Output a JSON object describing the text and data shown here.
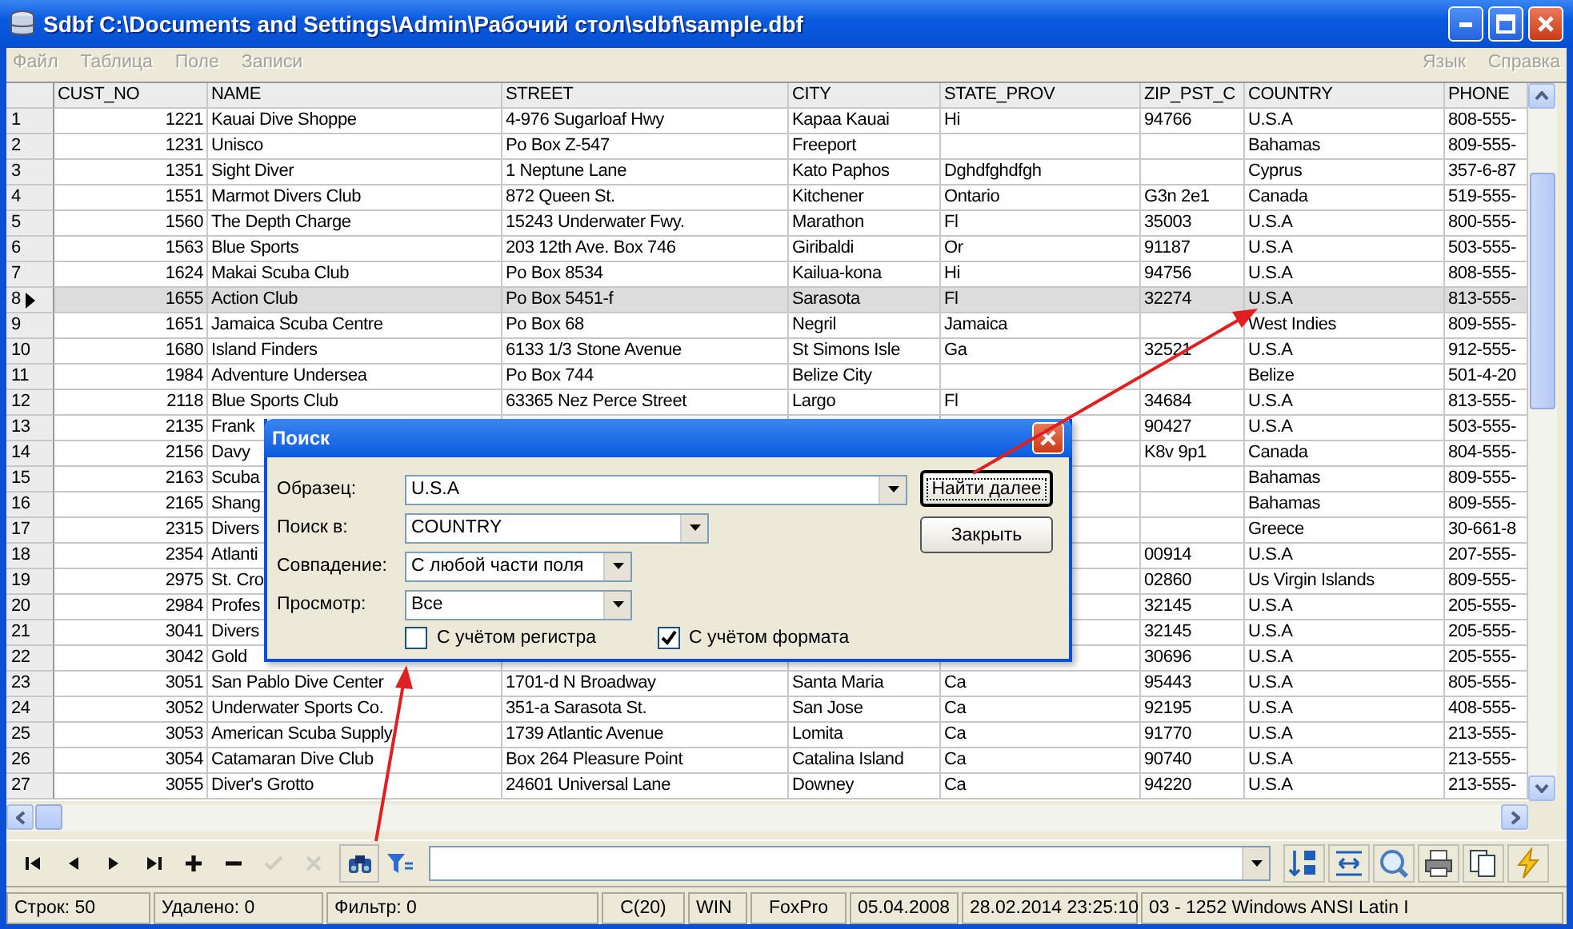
{
  "window": {
    "title": "Sdbf C:\\Documents and Settings\\Admin\\Рабочий стол\\sdbf\\sample.dbf"
  },
  "menu": {
    "left": [
      "Файл",
      "Таблица",
      "Поле",
      "Записи"
    ],
    "right": [
      "Язык",
      "Справка"
    ]
  },
  "table": {
    "columns": [
      "CUST_NO",
      "NAME",
      "STREET",
      "CITY",
      "STATE_PROV",
      "ZIP_PST_C",
      "COUNTRY",
      "PHONE"
    ],
    "rows": [
      {
        "number": "1",
        "selected": false,
        "cells": [
          "1221",
          "Kauai Dive Shoppe",
          "4-976 Sugarloaf Hwy",
          "Kapaa Kauai",
          "Hi",
          "94766",
          "U.S.A",
          "808-555-"
        ]
      },
      {
        "number": "2",
        "selected": false,
        "cells": [
          "1231",
          "Unisco",
          "Po Box Z-547",
          "Freeport",
          null,
          null,
          "Bahamas",
          "809-555-"
        ]
      },
      {
        "number": "3",
        "selected": false,
        "cells": [
          "1351",
          "Sight Diver",
          "1 Neptune Lane",
          "Kato Paphos",
          "Dghdfghdfgh",
          null,
          "Cyprus",
          "357-6-87"
        ]
      },
      {
        "number": "4",
        "selected": false,
        "cells": [
          "1551",
          "Marmot Divers Club",
          "872 Queen St.",
          "Kitchener",
          "Ontario",
          "G3n 2e1",
          "Canada",
          "519-555-"
        ]
      },
      {
        "number": "5",
        "selected": false,
        "cells": [
          "1560",
          "The Depth Charge",
          "15243 Underwater Fwy.",
          "Marathon",
          "Fl",
          "35003",
          "U.S.A",
          "800-555-"
        ]
      },
      {
        "number": "6",
        "selected": false,
        "cells": [
          "1563",
          "Blue Sports",
          "203 12th Ave. Box 746",
          "Giribaldi",
          "Or",
          "91187",
          "U.S.A",
          "503-555-"
        ]
      },
      {
        "number": "7",
        "selected": false,
        "cells": [
          "1624",
          "Makai Scuba Club",
          "Po Box 8534",
          "Kailua-kona",
          "Hi",
          "94756",
          "U.S.A",
          "808-555-"
        ]
      },
      {
        "number": "8",
        "selected": true,
        "cells": [
          "1655",
          "Action Club",
          "Po Box 5451-f",
          "Sarasota",
          "Fl",
          "32274",
          "U.S.A",
          "813-555-"
        ]
      },
      {
        "number": "9",
        "selected": false,
        "cells": [
          "1651",
          "Jamaica Scuba Centre",
          "Po Box 68",
          "Negril",
          "Jamaica",
          null,
          "West Indies",
          "809-555-"
        ]
      },
      {
        "number": "10",
        "selected": false,
        "cells": [
          "1680",
          "Island Finders",
          "6133 1/3 Stone Avenue",
          "St Simons Isle",
          "Ga",
          "32521",
          "U.S.A",
          "912-555-"
        ]
      },
      {
        "number": "11",
        "selected": false,
        "cells": [
          "1984",
          "Adventure Undersea",
          "Po Box 744",
          "Belize City",
          null,
          null,
          "Belize",
          "501-4-20"
        ]
      },
      {
        "number": "12",
        "selected": false,
        "cells": [
          "2118",
          "Blue Sports Club",
          "63365 Nez Perce Street",
          "Largo",
          "Fl",
          "34684",
          "U.S.A",
          "813-555-"
        ]
      },
      {
        "number": "13",
        "selected": false,
        "cells": [
          "2135",
          "Frank",
          null,
          null,
          null,
          "90427",
          "U.S.A",
          "503-555-"
        ]
      },
      {
        "number": "14",
        "selected": false,
        "cells": [
          "2156",
          "Davy",
          null,
          null,
          null,
          "K8v 9p1",
          "Canada",
          "804-555-"
        ]
      },
      {
        "number": "15",
        "selected": false,
        "cells": [
          "2163",
          "Scuba",
          null,
          null,
          null,
          null,
          "Bahamas",
          "809-555-"
        ]
      },
      {
        "number": "16",
        "selected": false,
        "cells": [
          "2165",
          "Shang",
          null,
          null,
          null,
          null,
          "Bahamas",
          "809-555-"
        ]
      },
      {
        "number": "17",
        "selected": false,
        "cells": [
          "2315",
          "Divers",
          null,
          null,
          null,
          null,
          "Greece",
          "30-661-8"
        ]
      },
      {
        "number": "18",
        "selected": false,
        "cells": [
          "2354",
          "Atlanti",
          null,
          null,
          null,
          "00914",
          "U.S.A",
          "207-555-"
        ]
      },
      {
        "number": "19",
        "selected": false,
        "cells": [
          "2975",
          "St. Cro",
          null,
          null,
          null,
          "02860",
          "Us Virgin Islands",
          "809-555-"
        ]
      },
      {
        "number": "20",
        "selected": false,
        "cells": [
          "2984",
          "Profes",
          null,
          null,
          null,
          "32145",
          "U.S.A",
          "205-555-"
        ]
      },
      {
        "number": "21",
        "selected": false,
        "cells": [
          "3041",
          "Divers",
          null,
          null,
          null,
          "32145",
          "U.S.A",
          "205-555-"
        ]
      },
      {
        "number": "22",
        "selected": false,
        "cells": [
          "3042",
          "Gold",
          null,
          null,
          null,
          "30696",
          "U.S.A",
          "205-555-"
        ]
      },
      {
        "number": "23",
        "selected": false,
        "cells": [
          "3051",
          "San Pablo Dive Center",
          "1701-d N Broadway",
          "Santa Maria",
          "Ca",
          "95443",
          "U.S.A",
          "805-555-"
        ]
      },
      {
        "number": "24",
        "selected": false,
        "cells": [
          "3052",
          "Underwater Sports Co.",
          "351-a Sarasota St.",
          "San Jose",
          "Ca",
          "92195",
          "U.S.A",
          "408-555-"
        ]
      },
      {
        "number": "25",
        "selected": false,
        "cells": [
          "3053",
          "American Scuba Supply",
          "1739 Atlantic Avenue",
          "Lomita",
          "Ca",
          "91770",
          "U.S.A",
          "213-555-"
        ]
      },
      {
        "number": "26",
        "selected": false,
        "cells": [
          "3054",
          "Catamaran Dive Club",
          "Box 264 Pleasure Point",
          "Catalina Island",
          "Ca",
          "90740",
          "U.S.A",
          "213-555-"
        ]
      },
      {
        "number": "27",
        "selected": false,
        "cells": [
          "3055",
          "Diver's Grotto",
          "24601 Universal Lane",
          "Downey",
          "Ca",
          "94220",
          "U.S.A",
          "213-555-"
        ]
      }
    ]
  },
  "dialog": {
    "title": "Поиск",
    "fields": [
      {
        "label": "Образец:",
        "value": "U.S.A"
      },
      {
        "label": "Поиск в:",
        "value": "COUNTRY"
      },
      {
        "label": "Совпадение:",
        "value": "С любой части поля"
      },
      {
        "label": "Просмотр:",
        "value": "Все"
      }
    ],
    "checkboxes": [
      {
        "label": "С учётом регистра",
        "checked": false
      },
      {
        "label": "С учётом формата",
        "checked": true
      }
    ],
    "buttons": [
      {
        "label": "Найти далее",
        "default": true
      },
      {
        "label": "Закрыть",
        "default": false
      }
    ]
  },
  "toolbar": {
    "buttons": [
      {
        "kind": "first",
        "disabled": false
      },
      {
        "kind": "prev",
        "disabled": false
      },
      {
        "kind": "next",
        "disabled": false
      },
      {
        "kind": "last",
        "disabled": false
      },
      {
        "kind": "add",
        "disabled": false
      },
      {
        "kind": "remove",
        "disabled": false
      },
      {
        "kind": "confirm",
        "disabled": true
      },
      {
        "kind": "cancel",
        "disabled": true
      },
      {
        "kind": "find",
        "disabled": false
      },
      {
        "kind": "filter",
        "disabled": false
      }
    ],
    "tools": [
      {
        "kind": "sort"
      },
      {
        "kind": "fit"
      },
      {
        "kind": "zoom"
      },
      {
        "kind": "print"
      },
      {
        "kind": "copy"
      },
      {
        "kind": "bolt"
      }
    ]
  },
  "status_bar": [
    "Строк: 50",
    "Удалено: 0",
    "Фильтр: 0",
    "C(20)",
    "WIN",
    "FoxPro",
    "05.04.2008",
    "28.02.2014 23:25:10",
    "03 - 1252 Windows ANSI Latin I"
  ]
}
